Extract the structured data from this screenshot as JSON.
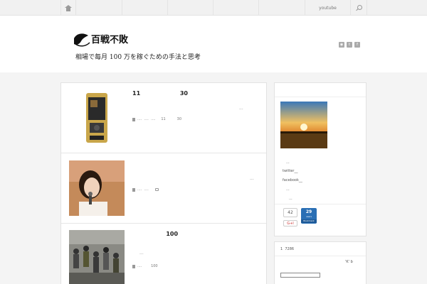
{
  "topnav": {
    "youtube_label": "youtube"
  },
  "header": {
    "logo_text": "百戦不敗",
    "tagline": "相場で毎月 100 万を稼ぐための手法と思考"
  },
  "posts": [
    {
      "title": "11                    30",
      "more": "...",
      "meta": "....  ....  ....     11          30"
    },
    {
      "title": "",
      "more": "...",
      "meta": "....  ....      "
    },
    {
      "title": "                 100",
      "more": "...",
      "meta": "....        100"
    }
  ],
  "sidebar": {
    "line1": "...",
    "twitter": "twitter__",
    "facebook": "facebook__",
    "line4": "...",
    "line5": "...",
    "share_count": "42",
    "gplus_label": "G+I",
    "hatena_count": "29",
    "hatena_unit": "users",
    "hatena_label": "Bookmark",
    "widget2_line1": "1  7286",
    "widget2_line2": "'K' b"
  },
  "colors": {
    "hatena": "#2a6fb5",
    "accent": "#333333"
  }
}
